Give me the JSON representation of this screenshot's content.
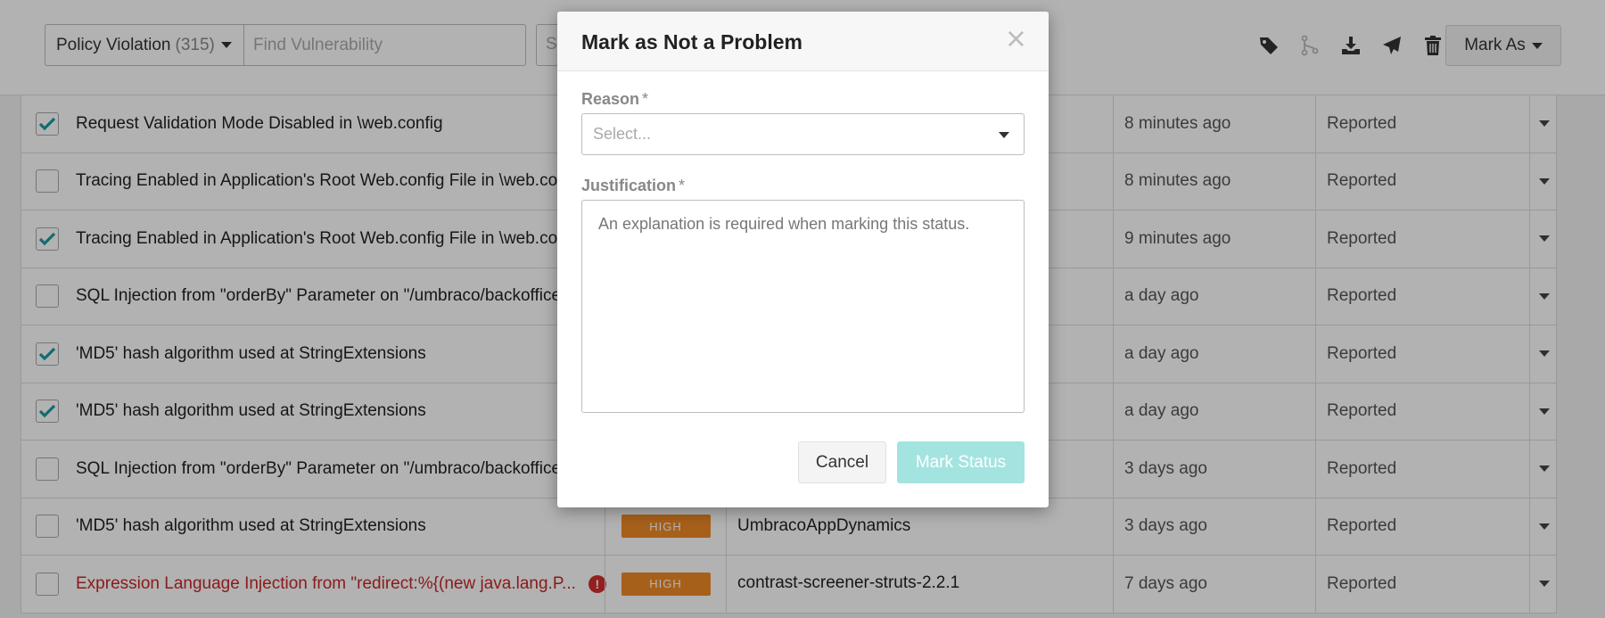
{
  "toolbar": {
    "filter_label": "Policy Violation",
    "filter_count": "(315)",
    "search_placeholder": "Find Vulnerability",
    "search2_placeholder": "Se",
    "mark_as_label": "Mark As",
    "icons": [
      "tag-icon",
      "merge-icon",
      "download-icon",
      "send-icon",
      "trash-icon"
    ]
  },
  "rows": [
    {
      "title": "Request Validation Mode Disabled in \\web.config",
      "checked": true,
      "severity": "",
      "app": "",
      "time": "8 minutes ago",
      "status": "Reported",
      "error": false
    },
    {
      "title": "Tracing Enabled in Application's Root Web.config File in \\web.config",
      "checked": false,
      "severity": "",
      "app": "",
      "time": "8 minutes ago",
      "status": "Reported",
      "error": false
    },
    {
      "title": "Tracing Enabled in Application's Root Web.config File in \\web.config",
      "checked": true,
      "severity": "",
      "app": "",
      "time": "9 minutes ago",
      "status": "Reported",
      "error": false
    },
    {
      "title": "SQL Injection from \"orderBy\" Parameter on \"/umbraco/backoffice\"",
      "checked": false,
      "severity": "",
      "app": "",
      "time": "a day ago",
      "status": "Reported",
      "error": false
    },
    {
      "title": "'MD5' hash algorithm used at StringExtensions",
      "checked": true,
      "severity": "",
      "app": "",
      "time": "a day ago",
      "status": "Reported",
      "error": false
    },
    {
      "title": "'MD5' hash algorithm used at StringExtensions",
      "checked": true,
      "severity": "",
      "app": "",
      "time": "a day ago",
      "status": "Reported",
      "error": false
    },
    {
      "title": "SQL Injection from \"orderBy\" Parameter on \"/umbraco/backoffice\"",
      "checked": false,
      "severity": "",
      "app": "",
      "time": "3 days ago",
      "status": "Reported",
      "error": false
    },
    {
      "title": "'MD5' hash algorithm used at StringExtensions",
      "checked": false,
      "severity": "HIGH",
      "app": "UmbracoAppDynamics",
      "time": "3 days ago",
      "status": "Reported",
      "error": false
    },
    {
      "title": "Expression Language Injection from \"redirect:%{(new java.lang.P...",
      "checked": false,
      "severity": "HIGH",
      "app": "contrast-screener-struts-2.2.1",
      "time": "7 days ago",
      "status": "Reported",
      "error": true
    }
  ],
  "modal": {
    "title": "Mark as Not a Problem",
    "close_glyph": "×",
    "reason_label": "Reason",
    "required_mark": "*",
    "reason_placeholder": "Select...",
    "justification_label": "Justification",
    "justification_placeholder": "An explanation is required when marking this status.",
    "cancel_label": "Cancel",
    "submit_label": "Mark Status"
  },
  "colors": {
    "accent_teal": "#1a9ba0",
    "severity_high": "#f08a24",
    "error_red": "#c62828",
    "submit_disabled": "#a3e4e0"
  }
}
